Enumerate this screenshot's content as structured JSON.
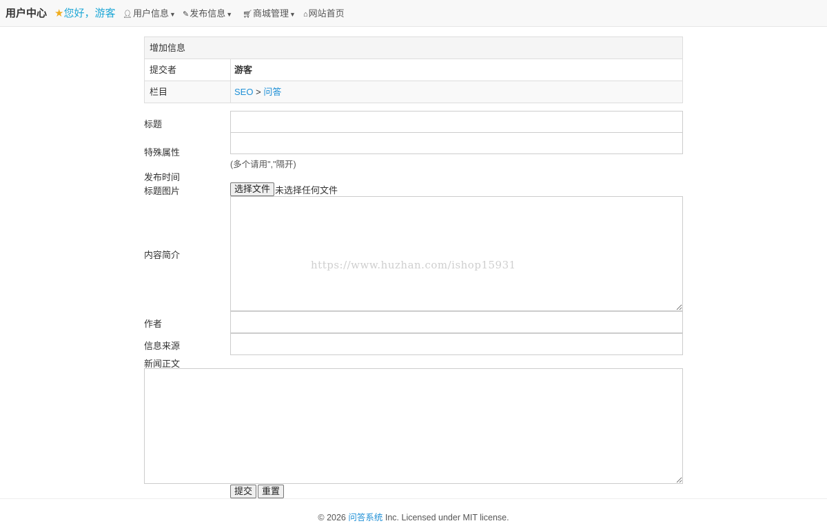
{
  "navbar": {
    "brand": "用户中心",
    "greeting": "您好，游客",
    "menus": [
      {
        "label": "用户信息",
        "icon": "user-icon"
      },
      {
        "label": "发布信息",
        "icon": "edit-icon"
      },
      {
        "label": "商城管理",
        "icon": "cart-icon"
      },
      {
        "label": "网站首页",
        "icon": "home-icon"
      }
    ]
  },
  "info": {
    "header": "增加信息",
    "submitter_label": "提交者",
    "submitter_value": "游客",
    "column_label": "栏目",
    "column_path": [
      "SEO",
      ">",
      "问答"
    ]
  },
  "form": {
    "title_label": "标题",
    "special_label": "特殊属性",
    "special_hint": "(多个请用\",\"隔开)",
    "publish_time_label": "发布时间",
    "title_image_label": "标题图片",
    "file_button": "选择文件",
    "file_status": "未选择任何文件",
    "summary_label": "内容简介",
    "author_label": "作者",
    "source_label": "信息来源",
    "body_label": "新闻正文",
    "submit_label": "提交",
    "reset_label": "重置"
  },
  "watermark": "https://www.huzhan.com/ishop15931",
  "footer": {
    "copyright": "© 2026",
    "site_name": "问答系统",
    "license": "Inc. Licensed under MIT license."
  },
  "colors": {
    "accent": "#1ea7d6",
    "link": "#1e8fd6",
    "star": "#f0ad1d"
  }
}
